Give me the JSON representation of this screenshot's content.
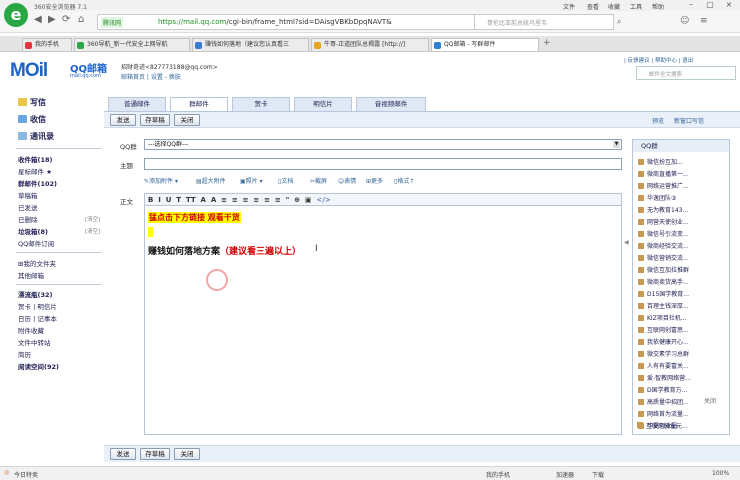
{
  "browser": {
    "title": "360安全浏览器 7.1",
    "menu": [
      "文件",
      "查看",
      "收藏",
      "工具",
      "帮助"
    ],
    "brand_tag": "腾讯网",
    "url_host": "https://mail.qq.com",
    "url_path": "/cgi-bin/frame_html?sid=DAisgVBKbDpqNAVT&",
    "search_placeholder": "哥伦比亚前总统乌里韦",
    "tabs": [
      {
        "label": "我的手机",
        "color": "#e0363e"
      },
      {
        "label": "360导航_新一代安全上网导航",
        "color": "#2aa74a"
      },
      {
        "label": "赚钱如何落地（建议您认真看三",
        "color": "#3b7bd1"
      },
      {
        "label": "牛哥-正道团队总揭露 [http://]",
        "color": "#e8a320"
      },
      {
        "label": "QQ邮箱 - 写群邮件",
        "color": "#2d7fd8"
      }
    ]
  },
  "mail": {
    "logo": "MOil",
    "logo_text": "QQ邮箱",
    "logo_domain": "mail.qq.com",
    "user": "招财奇迹<827773188@qq.com>",
    "user_links": "邮箱首页 | 设置 - 换肤",
    "top_links": "| 反馈建议 | 帮助中心 | 退出",
    "search_placeholder": "邮件全文搜索"
  },
  "sidebar": {
    "write": "写信",
    "inbox": "收信",
    "contacts": "通讯录",
    "folders": [
      {
        "label": "收件箱(18)",
        "bold": true
      },
      {
        "label": "星标邮件 ★",
        "bold": false
      },
      {
        "label": "群邮件(102)",
        "bold": true
      },
      {
        "label": "草稿箱",
        "bold": false
      },
      {
        "label": "已发送",
        "bold": false
      },
      {
        "label": "已删除",
        "bold": false,
        "clear": "[清空]"
      },
      {
        "label": "垃圾箱(8)",
        "bold": true,
        "clear": "[清空]"
      },
      {
        "label": "QQ邮件订阅",
        "bold": false
      }
    ],
    "my_folders": "⊞我的文件夹",
    "other_mail": "其他邮箱",
    "apps": [
      {
        "label": "漂流瓶(32)",
        "bold": true
      },
      {
        "label": "贺卡 | 明信片",
        "bold": false
      },
      {
        "label": "日历 | 记事本",
        "bold": false
      },
      {
        "label": "附件收藏",
        "bold": false
      },
      {
        "label": "文件中转站",
        "bold": false
      },
      {
        "label": "简历",
        "bold": false
      },
      {
        "label": "阅读空间(92)",
        "bold": true
      }
    ]
  },
  "compose": {
    "type_tabs": [
      "普通邮件",
      "群邮件",
      "贺卡",
      "明信片",
      "音视频邮件"
    ],
    "send": "发送",
    "save_draft": "存草稿",
    "close": "关闭",
    "preview": "预览",
    "new_window": "新窗口写信",
    "qq_group_label": "QQ群",
    "qq_group_value": "---选择QQ群---",
    "subject_label": "主题",
    "body_label": "正文",
    "attachments": [
      "添加附件 ▾",
      "超大附件",
      "照片 ▾",
      "文档",
      "截屏",
      "表情",
      "更多",
      "格式↑"
    ],
    "format_buttons": [
      "B",
      "I",
      "U",
      "T",
      "TT",
      "A",
      "A",
      "≡",
      "≡",
      "≡",
      "≡",
      "≡",
      "≡",
      "\"",
      "⊕",
      "▣",
      "</>"
    ],
    "body_line1": "猛点击下方链接 观看干货",
    "body_line3_main": "赚钱如何落地方案",
    "body_line3_red": "（建议看三遍以上）"
  },
  "groups": {
    "title": "QQ群",
    "close": "关闭",
    "items": [
      "微信扮互加...",
      "微商直播第一...",
      "网络运营推广...",
      "华逸团队③",
      "无为教育143...",
      "网营天使创业...",
      "微信号引流变...",
      "微商经验交流...",
      "微信营销交流...",
      "微信互加拉推群",
      "微商卖货高手...",
      "D15国学教育...",
      "百理主钱深厚...",
      "KIZ项目社机...",
      "互联网创富思...",
      "我依健康开心...",
      "微交素学习总群",
      "人有有要富关...",
      "爱-智教网络营...",
      "D国学教育方...",
      "高质量中招团...",
      "网络首为流量...",
      "华夏创业圈",
      "互联网创业元..."
    ]
  },
  "statusbar": {
    "left": "今日特卖",
    "items": [
      "我的手机",
      "加速器",
      "下载",
      "100%"
    ]
  }
}
